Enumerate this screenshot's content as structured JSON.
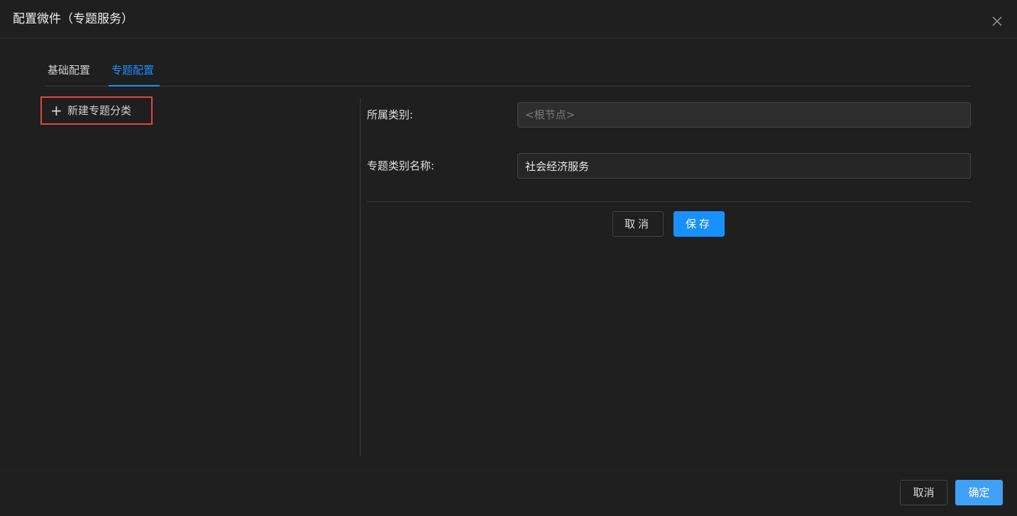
{
  "modal": {
    "title": "配置微件（专题服务）",
    "close_icon": "close-icon"
  },
  "tabs": [
    {
      "label": "基础配置",
      "active": false
    },
    {
      "label": "专题配置",
      "active": true
    }
  ],
  "sidebar": {
    "new_category_label": "新建专题分类",
    "new_category_icon": "plus-icon"
  },
  "form": {
    "parent_category_label": "所属类别:",
    "parent_category_placeholder": "<根节点>",
    "category_name_label": "专题类别名称:",
    "category_name_value": "社会经济服务",
    "cancel_label": "取消",
    "save_label": "保存"
  },
  "footer": {
    "cancel_label": "取消",
    "ok_label": "确定"
  },
  "colors": {
    "accent": "#1890ff",
    "highlight_border": "#e0463a",
    "background": "#1f1f1f"
  }
}
